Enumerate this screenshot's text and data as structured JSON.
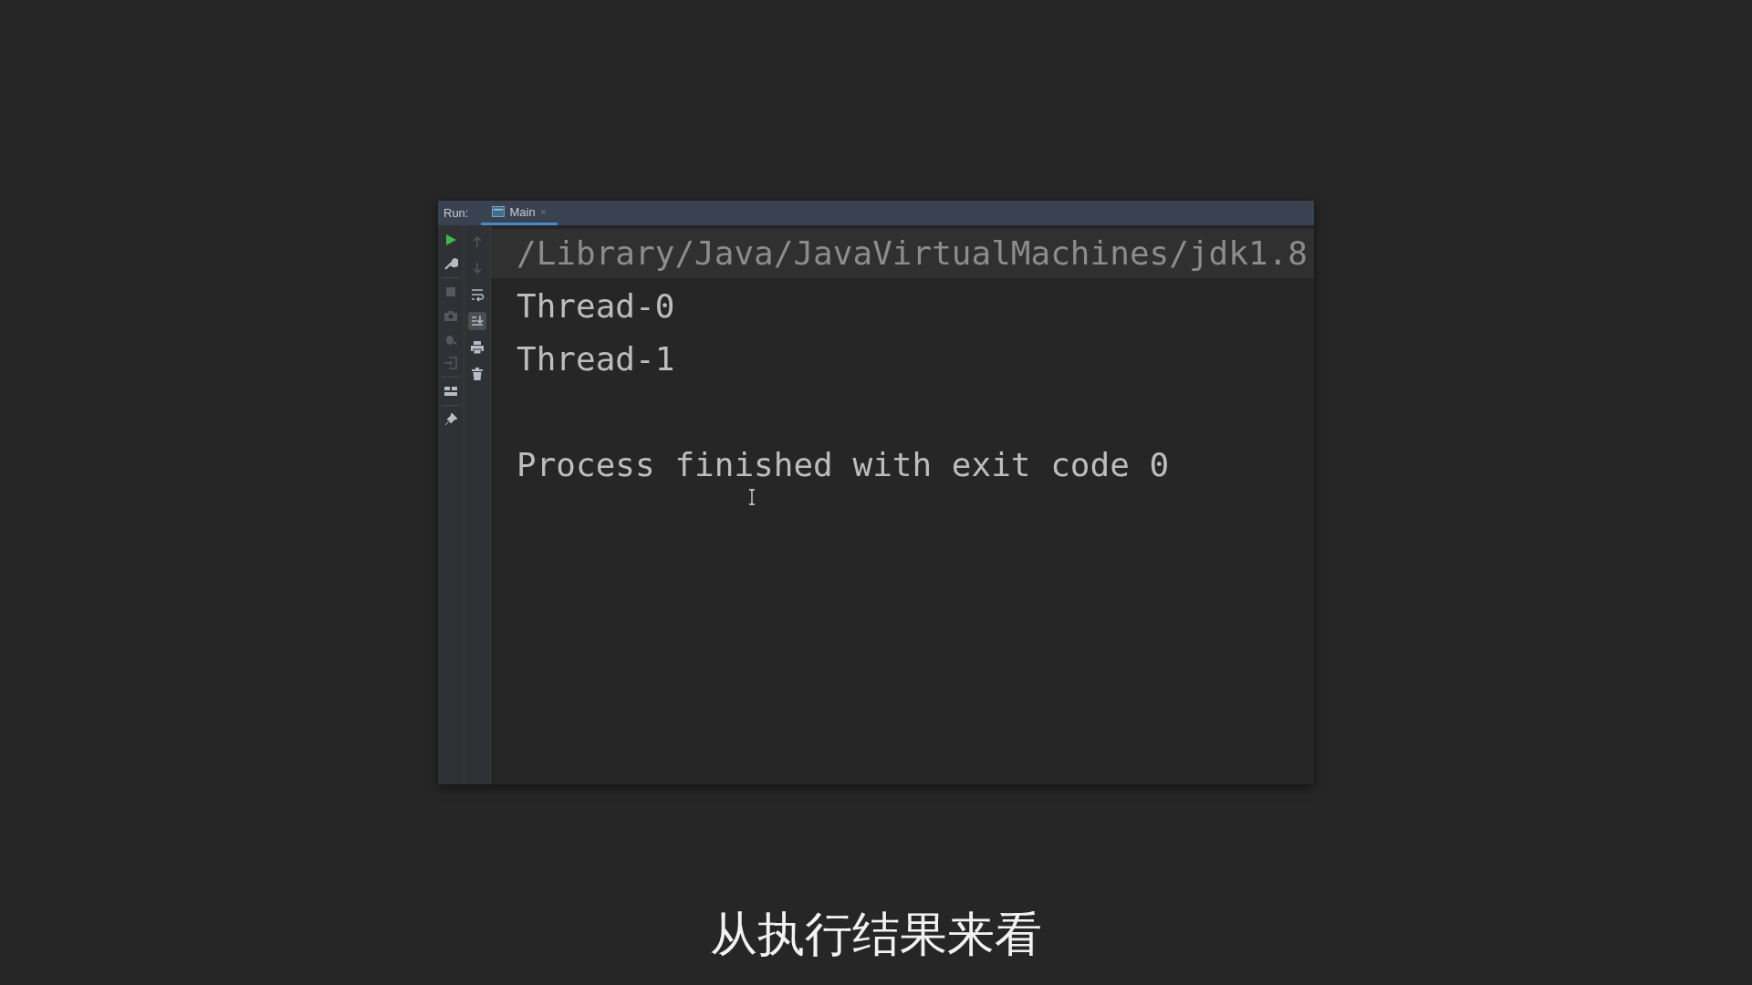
{
  "run_panel": {
    "label": "Run:",
    "tabs": [
      {
        "label": "Main",
        "close": "×",
        "selected": true
      }
    ],
    "left_toolbar": [
      {
        "disabled": false
      },
      {
        "disabled": false
      },
      {
        "disabled": true
      },
      {
        "disabled": true
      },
      {
        "disabled": true
      },
      {
        "disabled": true
      },
      {
        "disabled": false
      },
      {
        "disabled": false
      }
    ],
    "right_toolbar": [
      {
        "disabled": true,
        "selected": false
      },
      {
        "disabled": true,
        "selected": false
      },
      {
        "disabled": false,
        "selected": false
      },
      {
        "disabled": false,
        "selected": true
      },
      {
        "disabled": false,
        "selected": false
      },
      {
        "disabled": false,
        "selected": false
      }
    ],
    "console_lines": [
      {
        "kind": "command",
        "text": "/Library/Java/JavaVirtualMachines/jdk1.8"
      },
      {
        "kind": "output",
        "text": "Thread-0"
      },
      {
        "kind": "output",
        "text": "Thread-1"
      },
      {
        "kind": "blank"
      },
      {
        "kind": "output",
        "text": "Process finished with exit code 0"
      }
    ]
  },
  "subtitle": "从执行结果来看"
}
